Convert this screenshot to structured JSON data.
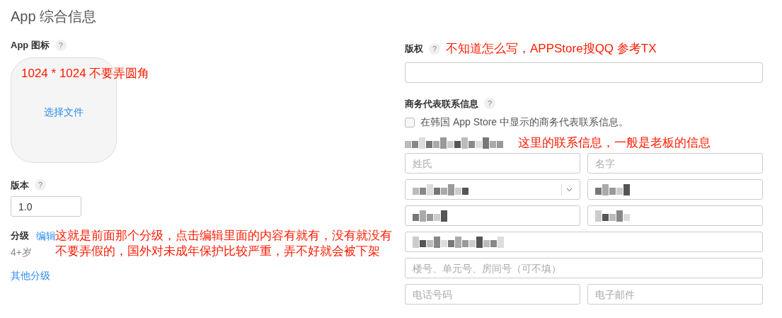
{
  "title": "App 综合信息",
  "left": {
    "icon_section": {
      "label": "App 图标",
      "help": "?",
      "annotation": "1024 * 1024 不要弄圆角",
      "choose_link": "选择文件"
    },
    "version": {
      "label": "版本",
      "help": "?",
      "value": "1.0"
    },
    "rating": {
      "label": "分级",
      "edit_link": "编辑",
      "value": "4+岁",
      "annotation": [
        "这就是前面那个分级，点击编辑里面的内容有就有，没有就没有",
        "不要弄假的，国外对未成年保护比较严重，弄不好就会被下架"
      ]
    },
    "other_ratings_link": "其他分级"
  },
  "right": {
    "copyright": {
      "label": "版权",
      "help": "?",
      "annotation": "不知道怎么写，APPStore搜QQ 参考TX"
    },
    "contact": {
      "label": "商务代表联系信息",
      "help": "?",
      "checkbox": {
        "label": "在韩国 App Store 中显示的商务代表联系信息。",
        "checked": false
      },
      "subheading_redacted": true,
      "annotation": "这里的联系信息，一般是老板的信息",
      "rows": [
        [
          {
            "kind": "input",
            "placeholder": "姓氏"
          },
          {
            "kind": "input",
            "placeholder": "名字"
          }
        ],
        [
          {
            "kind": "select",
            "redacted": true
          },
          {
            "kind": "input",
            "redacted": true
          }
        ],
        [
          {
            "kind": "input",
            "redacted": true
          },
          {
            "kind": "input",
            "redacted": true
          }
        ],
        [
          {
            "kind": "input",
            "redacted": true
          }
        ],
        [
          {
            "kind": "input",
            "placeholder": "楼号、单元号、房间号（可不填）"
          }
        ],
        [
          {
            "kind": "input",
            "placeholder": "电话号码"
          },
          {
            "kind": "input",
            "placeholder": "电子邮件"
          }
        ]
      ]
    }
  }
}
